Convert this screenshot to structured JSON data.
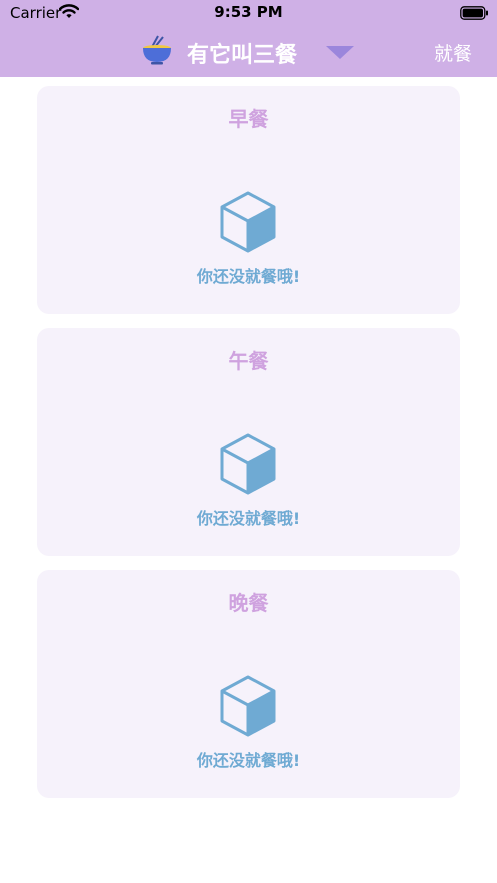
{
  "status": {
    "carrier": "Carrier",
    "time": "9:53 PM"
  },
  "nav": {
    "title": "有它叫三餐",
    "action": "就餐",
    "icons": [
      "bowl-icon",
      "dropdown-triangle-icon"
    ]
  },
  "meals": [
    {
      "title": "早餐",
      "empty_text": "你还没就餐哦!"
    },
    {
      "title": "午餐",
      "empty_text": "你还没就餐哦!"
    },
    {
      "title": "晚餐",
      "empty_text": "你还没就餐哦!"
    }
  ],
  "colors": {
    "header": "#cfb0e6",
    "card_background": "#f6f2fb",
    "meal_title": "#cfa2df",
    "empty_accent": "#6faad3",
    "dropdown": "#9b86dc"
  }
}
